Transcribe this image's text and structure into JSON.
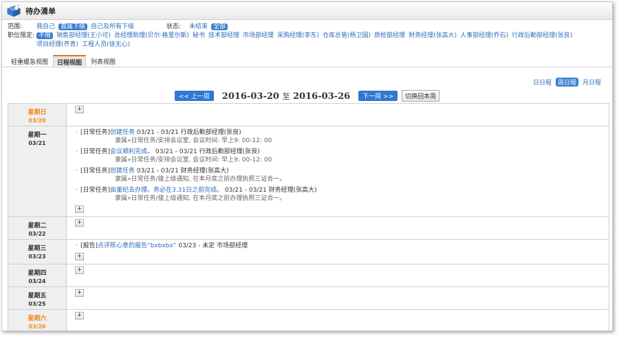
{
  "window": {
    "title": "待办清单"
  },
  "filters": {
    "scope_label": "范围:",
    "scope_options": [
      {
        "label": "我自己",
        "selected": false
      },
      {
        "label": "直属下级",
        "selected": true
      },
      {
        "label": "自己及所有下级",
        "selected": false
      }
    ],
    "status_label": "状态:",
    "status_options": [
      {
        "label": "未结束",
        "selected": false
      },
      {
        "label": "全部",
        "selected": true
      }
    ],
    "position_label": "职位限定:",
    "position_options": [
      {
        "label": "不限",
        "selected": true
      },
      {
        "label": "销售部经理(王小可)",
        "selected": false
      },
      {
        "label": "总经理助理(贝尔·格里尔斯)",
        "selected": false
      },
      {
        "label": "秘书",
        "selected": false
      },
      {
        "label": "技术部经理",
        "selected": false
      },
      {
        "label": "市场部经理",
        "selected": false
      },
      {
        "label": "采购经理(李东)",
        "selected": false
      },
      {
        "label": "仓库总管(杨卫国)",
        "selected": false
      },
      {
        "label": "质检部经理",
        "selected": false
      },
      {
        "label": "财务经理(张高大)",
        "selected": false
      },
      {
        "label": "人事部经理(乔石)",
        "selected": false
      },
      {
        "label": "行政后勤部经理(张良)",
        "selected": false
      },
      {
        "label": "项目经理(齐青)",
        "selected": false
      },
      {
        "label": "工程人员(徐无心)",
        "selected": false
      }
    ]
  },
  "tabs": [
    {
      "label": "轻重缓急视图",
      "active": false
    },
    {
      "label": "日程视图",
      "active": true
    },
    {
      "label": "列表视图",
      "active": false
    }
  ],
  "view_switch": [
    {
      "label": "日日程",
      "selected": false
    },
    {
      "label": "周日程",
      "selected": true
    },
    {
      "label": "月日程",
      "selected": false
    }
  ],
  "week_nav": {
    "prev": "<< 上一周",
    "start": "2016-03-20",
    "sep": "至",
    "end": "2016-03-26",
    "next": "下一周 >>",
    "today": "切换回本周"
  },
  "add_label": "+",
  "bullet": "◦",
  "days": [
    {
      "name": "星期日",
      "date": "03/20",
      "weekend": true,
      "tasks": []
    },
    {
      "name": "星期一",
      "date": "03/21",
      "weekend": false,
      "tasks": [
        {
          "prefix": "[日常任务]",
          "link": "创建任务",
          "tail": " 03/21 - 03/21  行政后勤部经理(张良)",
          "sub": "隶属»日常任务/安排会议室, 会议时间: 早上9: 00-12: 00"
        },
        {
          "prefix": "[日常任务]",
          "link": "会议顺利完成。",
          "tail": " 03/21 - 03/21  行政后勤部经理(张良)",
          "sub": "隶属»日常任务/安排会议室, 会议时间: 早上9: 00-12: 00"
        },
        {
          "prefix": "[日常任务]",
          "link": "创建任务",
          "tail": " 03/21 - 03/21  财务经理(张高大)",
          "sub": "隶属»日常任务/接上级通知, 在本月底之前办理执照三证合一。"
        },
        {
          "prefix": "[日常任务]",
          "link": "由董纪去办理。务必在3.31日之前完成。",
          "tail": " 03/21 - 03/21  财务经理(张高大)",
          "sub": "隶属»日常任务/接上级通知, 在本月底之前办理执照三证合一。"
        }
      ]
    },
    {
      "name": "星期二",
      "date": "03/22",
      "weekend": false,
      "tasks": []
    },
    {
      "name": "星期三",
      "date": "03/23",
      "weekend": false,
      "tasks": [
        {
          "prefix": "[报告]",
          "link": "点评陈心意的报告“bxbxbx”",
          "tail": " 03/23 - 未定  市场部经理",
          "sub": ""
        }
      ]
    },
    {
      "name": "星期四",
      "date": "03/24",
      "weekend": false,
      "tasks": []
    },
    {
      "name": "星期五",
      "date": "03/25",
      "weekend": false,
      "tasks": []
    },
    {
      "name": "星期六",
      "date": "03/26",
      "weekend": true,
      "tasks": []
    }
  ]
}
